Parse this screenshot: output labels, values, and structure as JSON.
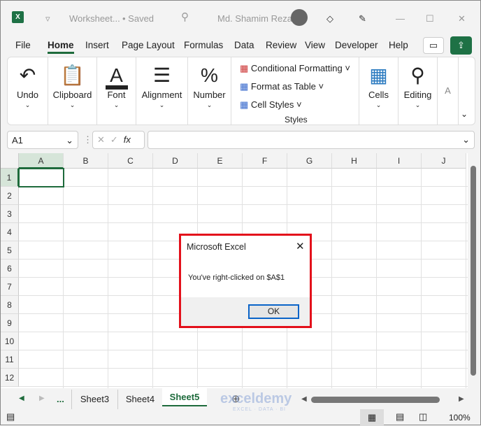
{
  "titlebar": {
    "app_icon": "excel-icon",
    "doc_name": "Worksheet...",
    "save_state": "• Saved",
    "user": "Md. Shamim Reza"
  },
  "menu_tabs": [
    "File",
    "Home",
    "Insert",
    "Page Layout",
    "Formulas",
    "Data",
    "Review",
    "View",
    "Developer",
    "Help"
  ],
  "active_tab": "Home",
  "ribbon": {
    "undo": "Undo",
    "clipboard": "Clipboard",
    "font": "Font",
    "alignment": "Alignment",
    "number": "Number",
    "conditional_formatting": "Conditional Formatting",
    "format_as_table": "Format as Table",
    "cell_styles": "Cell Styles",
    "styles_group": "Styles",
    "cells": "Cells",
    "editing": "Editing",
    "more": "A"
  },
  "formula_bar": {
    "name_box": "A1",
    "fx": "fx",
    "value": ""
  },
  "columns": [
    "A",
    "B",
    "C",
    "D",
    "E",
    "F",
    "G",
    "H",
    "I",
    "J"
  ],
  "rows": [
    "1",
    "2",
    "3",
    "4",
    "5",
    "6",
    "7",
    "8",
    "9",
    "10",
    "11",
    "12"
  ],
  "sheet_tabs": {
    "ellipsis": "...",
    "tabs": [
      "Sheet3",
      "Sheet4",
      "Sheet5"
    ],
    "active": "Sheet5"
  },
  "watermark": {
    "name": "exceldemy",
    "tagline": "EXCEL · DATA · BI"
  },
  "status": {
    "zoom": "100%"
  },
  "dialog": {
    "title": "Microsoft Excel",
    "message": "You've right-clicked on $A$1",
    "ok": "OK"
  },
  "colors": {
    "accent": "#1e6b3c",
    "dialog_border": "#e3101b"
  }
}
